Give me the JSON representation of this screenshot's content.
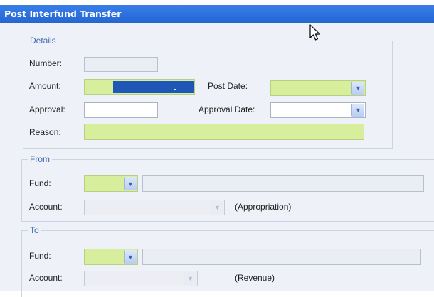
{
  "window": {
    "title": "Post Interfund Transfer"
  },
  "details": {
    "title": "Details",
    "number_label": "Number:",
    "amount_label": "Amount:",
    "post_date_label": "Post Date:",
    "approval_label": "Approval:",
    "approval_date_label": "Approval Date:",
    "reason_label": "Reason:"
  },
  "from": {
    "title": "From",
    "fund_label": "Fund:",
    "account_label": "Account:",
    "account_note": "(Appropriation)"
  },
  "to": {
    "title": "To",
    "fund_label": "Fund:",
    "account_label": "Account:",
    "account_note": "(Revenue)"
  },
  "icons": {
    "dropdown": "chevron-down-icon",
    "cursor": "mouse-pointer-icon"
  },
  "colors": {
    "title_bar": "#2b6fdc",
    "required_field": "#d7ef9c",
    "group_title": "#3e69b5"
  }
}
